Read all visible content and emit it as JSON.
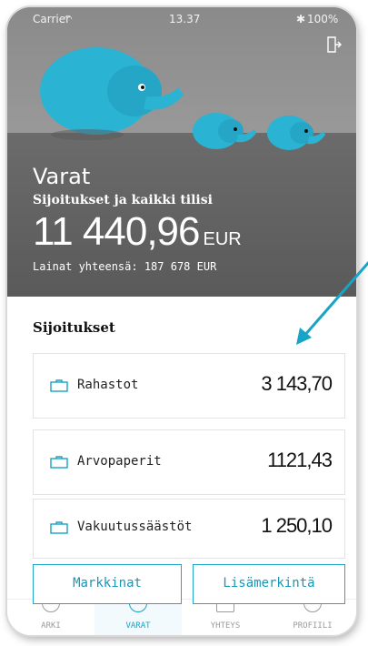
{
  "status_bar": {
    "carrier": "Carrier",
    "time": "13.37",
    "battery": "100%"
  },
  "header": {
    "title": "Varat",
    "subtitle": "Sijoitukset ja kaikki tilisi",
    "total_amount": "11 440,96",
    "currency": "EUR",
    "loans_text": "Lainat yhteensä: 187 678 EUR"
  },
  "section": {
    "title": "Sijoitukset"
  },
  "accounts": [
    {
      "label": "Rahastot",
      "value": "3 143,70"
    },
    {
      "label": "Arvopaperit",
      "value": "1121,43"
    },
    {
      "label": "Vakuutussäästöt",
      "value": "1 250,10"
    }
  ],
  "buttons": {
    "left": "Markkinat",
    "right": "Lisämerkintä"
  },
  "tabs": [
    {
      "label": "ARKI"
    },
    {
      "label": "VARAT"
    },
    {
      "label": "YHTEYS"
    },
    {
      "label": "PROFIILI"
    }
  ],
  "colors": {
    "accent": "#1aa2c2",
    "elephant": "#2bb3d3",
    "header_bg": "#6e6e6e"
  }
}
